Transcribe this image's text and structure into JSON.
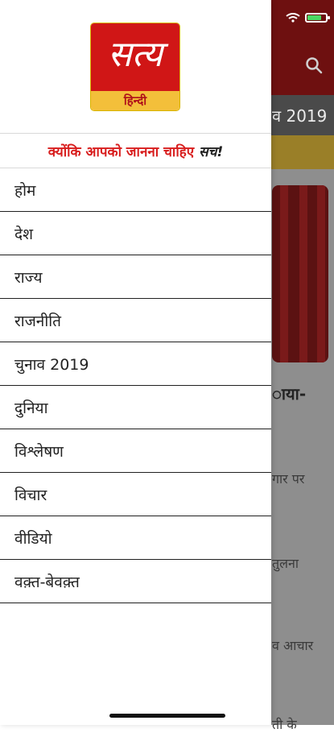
{
  "background": {
    "tab_partial_label": "व 2019",
    "article_title_partial": "ाया-",
    "article_lines": [
      "गार पर",
      "तुलना",
      "व आचार",
      "ती के"
    ]
  },
  "drawer": {
    "logo": {
      "word": "सत्य",
      "sub": "हिन्दी"
    },
    "tagline": {
      "main": "क्योंकि आपको जानना चाहिए",
      "emphasis": "सच!"
    },
    "menu_items": [
      "होम",
      "देश",
      "राज्य",
      "राजनीति",
      "चुनाव 2019",
      "दुनिया",
      "विश्लेषण",
      "विचार",
      "वीडियो",
      "वक़्त-बेवक़्त"
    ]
  },
  "colors": {
    "brand_red": "#d01616",
    "logo_yellow": "#f3bf3a",
    "tagline_red": "#d81d1d"
  }
}
